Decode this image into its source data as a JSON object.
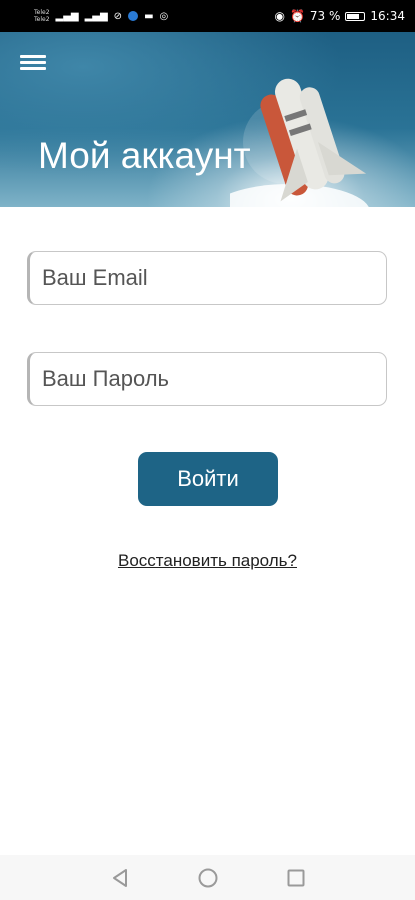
{
  "status_bar": {
    "carrier_1": "Tele2",
    "carrier_2": "Tele2",
    "battery_percent": "73 %",
    "battery_level": 0.73,
    "time": "16:34",
    "icons": [
      "signal-icon",
      "signal-icon",
      "mute-icon",
      "shield-icon",
      "keyboard-icon",
      "vpn-icon",
      "eye-icon",
      "alarm-icon",
      "battery-icon"
    ]
  },
  "header": {
    "title": "Мой аккаунт",
    "menu_icon": "hamburger-menu-icon",
    "background": "rocket-launch"
  },
  "form": {
    "email_placeholder": "Ваш Email",
    "email_value": "",
    "password_placeholder": "Ваш Пароль",
    "password_value": "",
    "login_label": "Войти",
    "forgot_label": "Восстановить пароль?"
  },
  "nav_bar": {
    "icons": [
      "back-icon",
      "home-icon",
      "recents-icon"
    ]
  },
  "colors": {
    "primary": "#1e6486",
    "header_top": "#1e5f83",
    "status_bar": "#000000"
  }
}
